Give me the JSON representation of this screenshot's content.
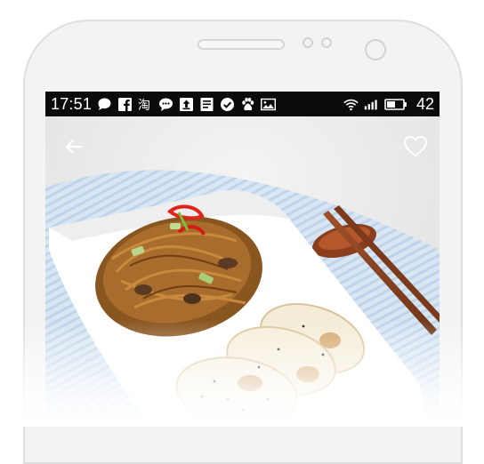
{
  "status_bar": {
    "time": "17:51",
    "battery_level": "42",
    "notification_icons": [
      "chat-bubble-icon",
      "facebook-icon",
      "taobao-icon",
      "message-icon",
      "upload-icon",
      "news-icon",
      "check-circle-icon",
      "baidu-paw-icon",
      "image-icon"
    ],
    "system_icons": [
      "wifi-icon",
      "signal-icon",
      "battery-icon"
    ]
  },
  "screen": {
    "back_icon": "arrow-left-icon",
    "favorite_icon": "heart-outline-icon",
    "photo": "fried-noodles-and-dumplings-on-white-plate"
  },
  "colors": {
    "status_bar_bg": "#0b0b0b",
    "icon_color": "#ffffff"
  }
}
